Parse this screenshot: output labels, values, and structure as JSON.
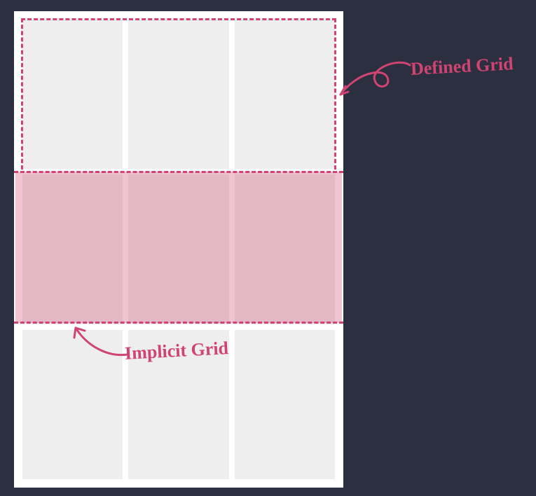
{
  "labels": {
    "defined": "Defined Grid",
    "implicit": "Implicit Grid"
  },
  "colors": {
    "background": "#2b2f40",
    "container": "#ffffff",
    "cell": "#eeeeee",
    "accent": "#d04471",
    "overlay": "rgba(208,68,113,0.32)"
  },
  "grid": {
    "columns": 3,
    "rows": 3,
    "defined_rows": 1,
    "implicit_band_row": 2
  }
}
